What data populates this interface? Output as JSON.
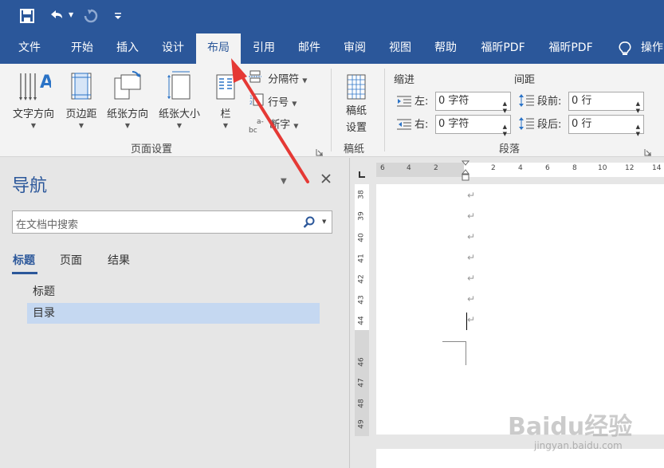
{
  "qat": {
    "save_icon": "save-icon",
    "undo_icon": "undo-icon",
    "redo_icon": "redo-icon",
    "customize_icon": "customize-qat-icon"
  },
  "ribbon_tabs": [
    "文件",
    "开始",
    "插入",
    "设计",
    "布局",
    "引用",
    "邮件",
    "审阅",
    "视图",
    "帮助",
    "福昕PDF",
    "福昕PDF"
  ],
  "tell_me": "操作",
  "page_setup": {
    "group_label": "页面设置",
    "text_direction": "文字方向",
    "margins": "页边距",
    "orientation": "纸张方向",
    "size": "纸张大小",
    "columns": "栏",
    "breaks": "分隔符",
    "line_numbers": "行号",
    "hyphenation": "断字",
    "hyph_icon_text": "a-\nbc"
  },
  "manuscript": {
    "group_label": "稿纸",
    "button_line1": "稿纸",
    "button_line2": "设置"
  },
  "paragraph": {
    "group_label": "段落",
    "indent_header": "缩进",
    "spacing_header": "间距",
    "left_label": "左:",
    "left_value": "0 字符",
    "right_label": "右:",
    "right_value": "0 字符",
    "before_label": "段前:",
    "before_value": "0 行",
    "after_label": "段后:",
    "after_value": "0 行"
  },
  "nav": {
    "title": "导航",
    "search_placeholder": "在文档中搜索",
    "tabs": [
      "标题",
      "页面",
      "结果"
    ],
    "headings": [
      {
        "label": "标题",
        "selected": false
      },
      {
        "label": "目录",
        "selected": true
      }
    ]
  },
  "ruler": {
    "h_ticks": [
      "6",
      "4",
      "2",
      "2",
      "4",
      "6",
      "8",
      "10",
      "12",
      "14"
    ],
    "v_ticks": [
      "38",
      "39",
      "40",
      "41",
      "42",
      "43",
      "44",
      "46",
      "47",
      "48",
      "49"
    ]
  },
  "watermark": {
    "line1": "Baidu经验",
    "line2": "jingyan.baidu.com"
  },
  "colors": {
    "brand": "#2b579a",
    "arrow": "#e53935",
    "nav_selected": "#c5d8f1"
  }
}
